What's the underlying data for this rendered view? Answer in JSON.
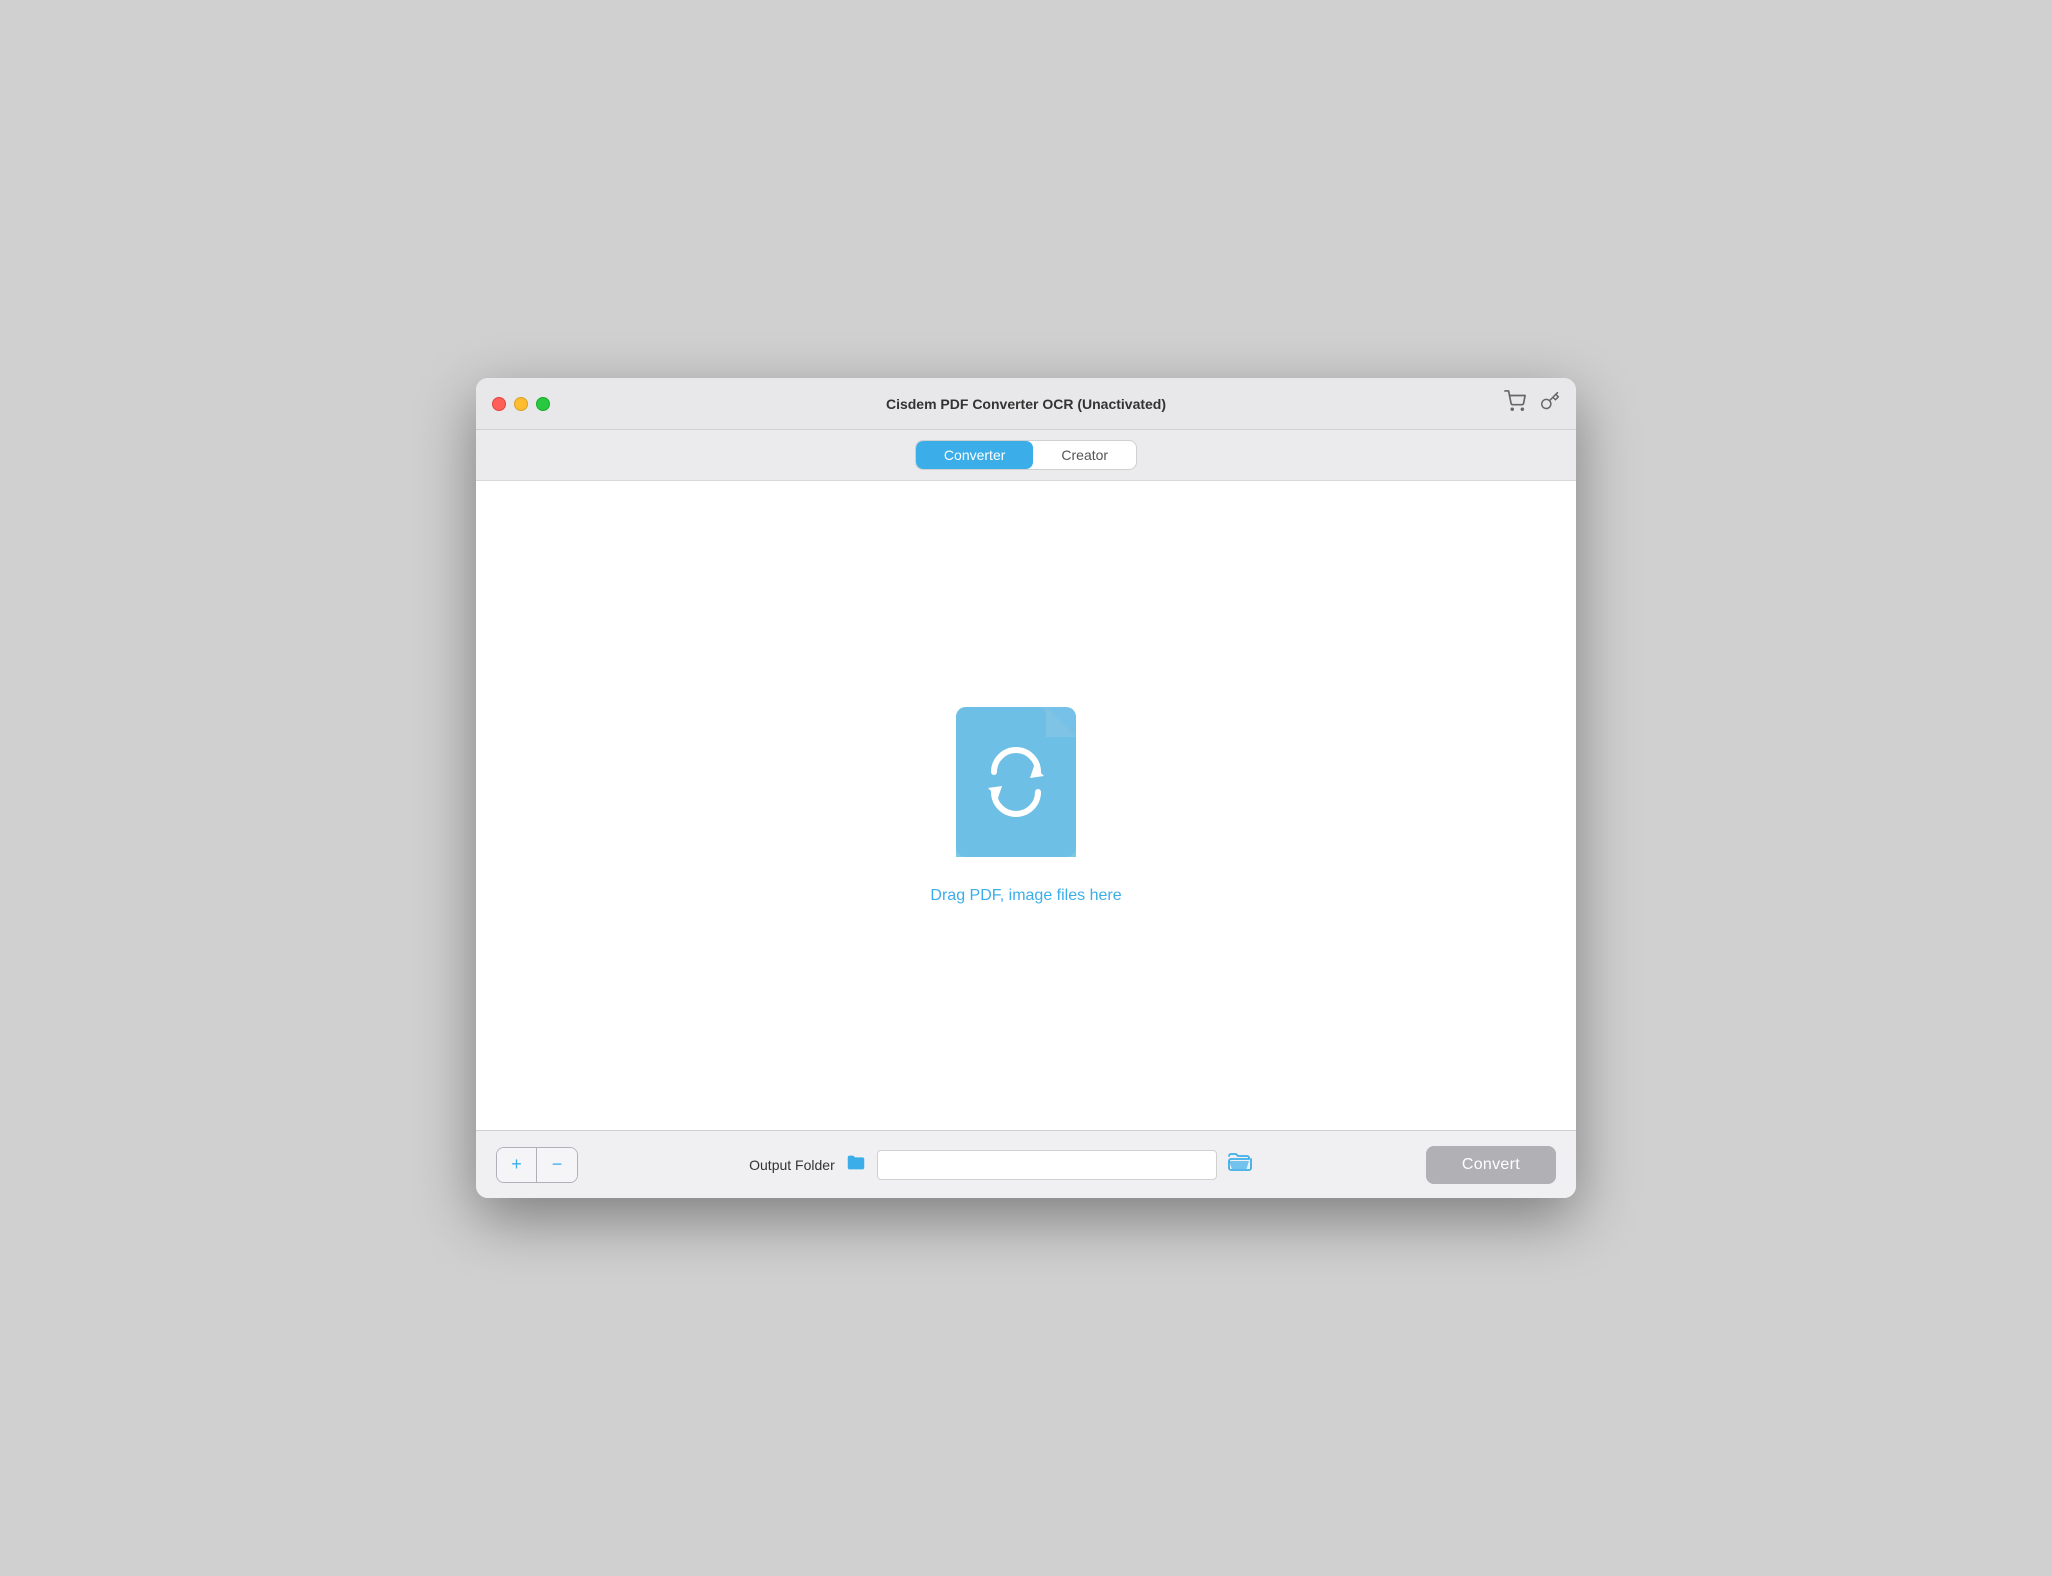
{
  "window": {
    "title": "Cisdem PDF Converter OCR (Unactivated)"
  },
  "titlebar": {
    "title": "Cisdem PDF Converter OCR (Unactivated)",
    "cart_icon": "🛒",
    "key_icon": "🔑"
  },
  "tabs": {
    "converter_label": "Converter",
    "creator_label": "Creator"
  },
  "main": {
    "drop_label": "Drag PDF, image files here"
  },
  "bottombar": {
    "add_label": "+",
    "remove_label": "−",
    "output_folder_label": "Output Folder",
    "output_path_value": "",
    "output_path_placeholder": "",
    "convert_label": "Convert"
  }
}
